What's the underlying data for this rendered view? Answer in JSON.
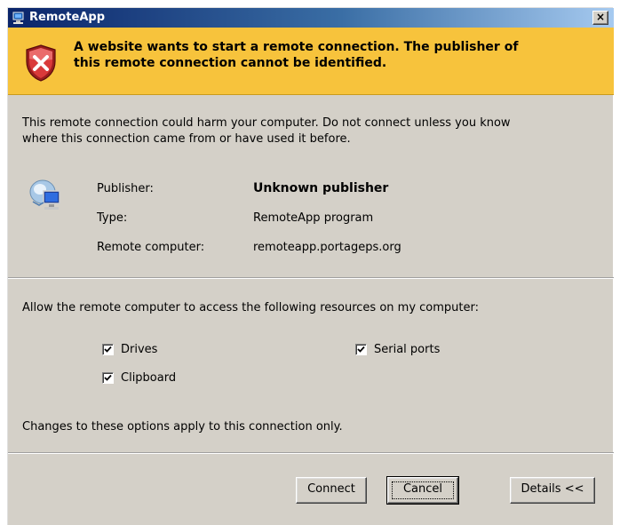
{
  "window": {
    "title": "RemoteApp",
    "close_symbol": "×"
  },
  "banner": {
    "icon": "shield-error-icon",
    "line1": "A website wants to start a remote connection. The publisher of",
    "line2": "this remote connection cannot be identified.",
    "color": "#f7c33c"
  },
  "warning": {
    "line1": "This remote connection could harm your computer. Do not connect unless you know",
    "line2": "where this connection came from or have used it before."
  },
  "info": {
    "icon": "remote-computer-icon",
    "rows": [
      {
        "label": "Publisher:",
        "value": "Unknown publisher"
      },
      {
        "label": "Type:",
        "value": "RemoteApp program"
      },
      {
        "label": "Remote computer:",
        "value": "remoteapp.portageps.org"
      }
    ]
  },
  "resources": {
    "prompt": "Allow the remote computer to access the following resources on my computer:",
    "options": [
      {
        "label": "Drives",
        "checked": true
      },
      {
        "label": "Serial ports",
        "checked": true
      },
      {
        "label": "Clipboard",
        "checked": true
      }
    ],
    "note": "Changes to these options apply to this connection only."
  },
  "buttons": {
    "connect": "Connect",
    "cancel": "Cancel",
    "details": "Details <<"
  }
}
